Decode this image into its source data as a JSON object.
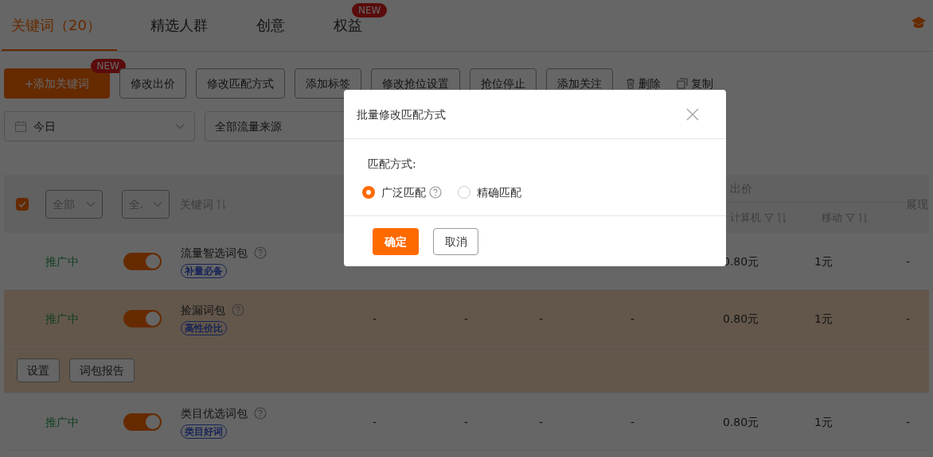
{
  "tabs": [
    {
      "label": "关键词（20）",
      "selected": true
    },
    {
      "label": "精选人群",
      "selected": false
    },
    {
      "label": "创意",
      "selected": false
    },
    {
      "label": "权益",
      "selected": false,
      "badge": "NEW"
    }
  ],
  "toolbar": [
    {
      "label": "+添加关键词",
      "kind": "primary",
      "badge": "NEW"
    },
    {
      "label": "修改出价",
      "kind": "outline"
    },
    {
      "label": "修改匹配方式",
      "kind": "outline"
    },
    {
      "label": "添加标签",
      "kind": "outline"
    },
    {
      "label": "修改抢位设置",
      "kind": "outline"
    },
    {
      "label": "抢位停止",
      "kind": "outline"
    },
    {
      "label": "添加关注",
      "kind": "outline"
    },
    {
      "label": "删除",
      "kind": "delete"
    },
    {
      "label": "复制",
      "kind": "copy"
    }
  ],
  "filters": {
    "date": "今日",
    "source": "全部流量来源"
  },
  "table": {
    "select_all_checked": true,
    "header_filters": [
      "全部",
      "全."
    ],
    "keyword_column": "关键词",
    "bid_group": "出价",
    "bid_columns": [
      "计算机",
      "移动"
    ],
    "last_column": "展现",
    "rows": [
      {
        "status": "推广中",
        "on": true,
        "name": "流量智选词包",
        "tag": "补量必备",
        "pc": "0.80元",
        "mobile": "1元",
        "last": "-",
        "highlighted": false
      },
      {
        "status": "推广中",
        "on": true,
        "name": "捡漏词包",
        "tag": "高性价比",
        "cells": [
          "-",
          "-",
          "-",
          "-"
        ],
        "pc": "0.80元",
        "mobile": "1元",
        "last": "-",
        "highlighted": true,
        "actions": [
          "设置",
          "词包报告"
        ]
      },
      {
        "status": "推广中",
        "on": true,
        "name": "类目优选词包",
        "tag": "类目好词",
        "cells": [
          "-",
          "-",
          "-",
          "-"
        ],
        "pc": "0.80元",
        "mobile": "1元",
        "last": "-",
        "highlighted": false
      }
    ]
  },
  "dialog": {
    "title": "批量修改匹配方式",
    "field_label": "匹配方式:",
    "options": [
      {
        "label": "广泛匹配",
        "selected": true,
        "help": true
      },
      {
        "label": "精确匹配",
        "selected": false,
        "help": false
      }
    ],
    "confirm": "确定",
    "cancel": "取消"
  }
}
